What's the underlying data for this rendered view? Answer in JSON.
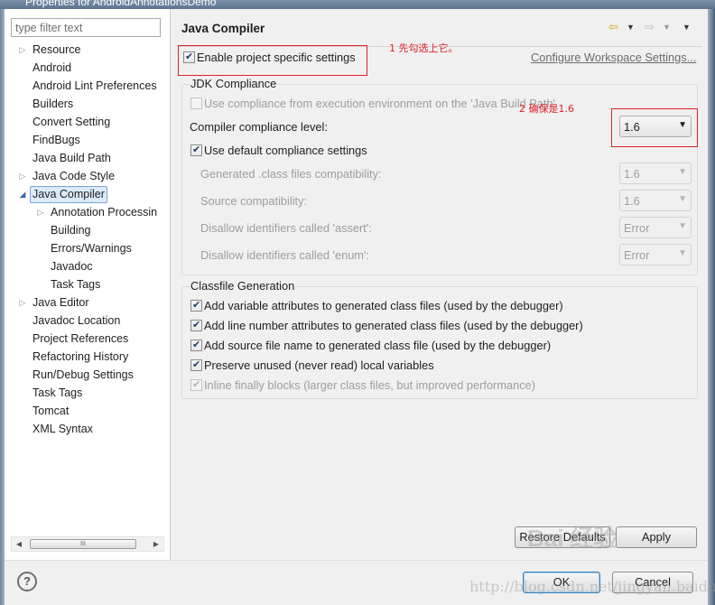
{
  "window": {
    "title": "Properties for AndroidAnnotationsDemo"
  },
  "sidebar": {
    "filter_placeholder": "type filter text",
    "items": [
      {
        "label": "Resource",
        "level": 0,
        "expandable": true
      },
      {
        "label": "Android",
        "level": 0,
        "expandable": false
      },
      {
        "label": "Android Lint Preferences",
        "level": 0,
        "expandable": false
      },
      {
        "label": "Builders",
        "level": 0,
        "expandable": false
      },
      {
        "label": "Convert Setting",
        "level": 0,
        "expandable": false
      },
      {
        "label": "FindBugs",
        "level": 0,
        "expandable": false
      },
      {
        "label": "Java Build Path",
        "level": 0,
        "expandable": false
      },
      {
        "label": "Java Code Style",
        "level": 0,
        "expandable": true
      },
      {
        "label": "Java Compiler",
        "level": 0,
        "expandable": true,
        "expanded": true,
        "selected": true
      },
      {
        "label": "Annotation Processin",
        "level": 1,
        "expandable": true
      },
      {
        "label": "Building",
        "level": 1,
        "expandable": false
      },
      {
        "label": "Errors/Warnings",
        "level": 1,
        "expandable": false
      },
      {
        "label": "Javadoc",
        "level": 1,
        "expandable": false
      },
      {
        "label": "Task Tags",
        "level": 1,
        "expandable": false
      },
      {
        "label": "Java Editor",
        "level": 0,
        "expandable": true
      },
      {
        "label": "Javadoc Location",
        "level": 0,
        "expandable": false
      },
      {
        "label": "Project References",
        "level": 0,
        "expandable": false
      },
      {
        "label": "Refactoring History",
        "level": 0,
        "expandable": false
      },
      {
        "label": "Run/Debug Settings",
        "level": 0,
        "expandable": false
      },
      {
        "label": "Task Tags",
        "level": 0,
        "expandable": false
      },
      {
        "label": "Tomcat",
        "level": 0,
        "expandable": false
      },
      {
        "label": "XML Syntax",
        "level": 0,
        "expandable": false
      }
    ],
    "scroll_thumb": "III"
  },
  "page": {
    "title": "Java Compiler",
    "enable_specific": {
      "label": "Enable project specific settings",
      "checked": true
    },
    "configure_link": "Configure Workspace Settings...",
    "annotation_1": "1 先勾选上它。",
    "annotation_2": "2 确保是1.6",
    "jdk": {
      "title": "JDK Compliance",
      "use_env": {
        "label": "Use compliance from execution environment on the 'Java Build Path'",
        "checked": false
      },
      "level_label": "Compiler compliance level:",
      "level_value": "1.6",
      "use_default": {
        "label": "Use default compliance settings",
        "checked": true
      },
      "rows": [
        {
          "label": "Generated .class files compatibility:",
          "value": "1.6"
        },
        {
          "label": "Source compatibility:",
          "value": "1.6"
        },
        {
          "label": "Disallow identifiers called 'assert':",
          "value": "Error"
        },
        {
          "label": "Disallow identifiers called 'enum':",
          "value": "Error"
        }
      ]
    },
    "classfile": {
      "title": "Classfile Generation",
      "options": [
        {
          "label": "Add variable attributes to generated class files (used by the debugger)",
          "checked": true,
          "disabled": false
        },
        {
          "label": "Add line number attributes to generated class files (used by the debugger)",
          "checked": true,
          "disabled": false
        },
        {
          "label": "Add source file name to generated class file (used by the debugger)",
          "checked": true,
          "disabled": false
        },
        {
          "label": "Preserve unused (never read) local variables",
          "checked": true,
          "disabled": false
        },
        {
          "label": "Inline finally blocks (larger class files, but improved performance)",
          "checked": true,
          "disabled": true
        }
      ]
    },
    "restore_defaults": "Restore Defaults",
    "apply": "Apply"
  },
  "dialog": {
    "ok": "OK",
    "cancel": "Cancel",
    "help_glyph": "?"
  },
  "watermark": {
    "logo": "Bai 经验",
    "url": "http://blog.csdn.net/jingyan.baidu.com"
  },
  "colors": {
    "annotation": "#e0202a",
    "selection": "#dcebfc"
  }
}
